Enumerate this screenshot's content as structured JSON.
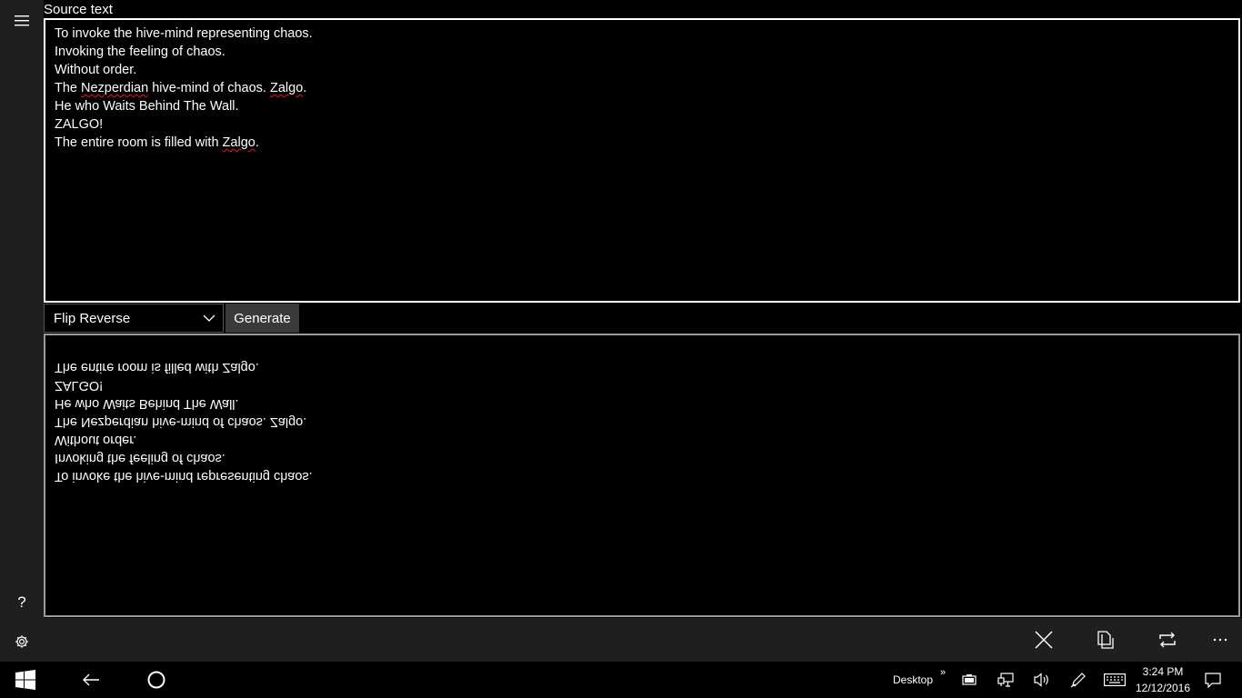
{
  "source": {
    "label": "Source text",
    "lines": [
      {
        "parts": [
          {
            "t": "To invoke the hive-mind representing chaos."
          }
        ]
      },
      {
        "parts": [
          {
            "t": "Invoking the feeling of chaos."
          }
        ]
      },
      {
        "parts": [
          {
            "t": "Without order."
          }
        ]
      },
      {
        "parts": [
          {
            "t": "The "
          },
          {
            "t": "Nezperdian",
            "spell": true
          },
          {
            "t": " hive-mind of chaos. "
          },
          {
            "t": "Zalgo",
            "spell": true
          },
          {
            "t": "."
          }
        ]
      },
      {
        "parts": [
          {
            "t": "He who Waits Behind The Wall."
          }
        ]
      },
      {
        "parts": [
          {
            "t": "ZALGO!"
          }
        ]
      },
      {
        "parts": [
          {
            "t": "The entire room is filled with "
          },
          {
            "t": "Zalgo",
            "spell": true
          },
          {
            "t": "."
          }
        ]
      }
    ]
  },
  "controls": {
    "mode_selected": "Flip Reverse",
    "generate_label": "Generate"
  },
  "output": {
    "lines": [
      "The entire room is filled with Zalgo.",
      "ZALGO!",
      "He who Waits Behind The Wall.",
      "The Nezperdian hive-mind of chaos. Zalgo.",
      "Without order.",
      "Invoking the feeling of chaos.",
      "To invoke the hive-mind representing chaos."
    ]
  },
  "rail": {
    "icons": [
      "hamburger-menu-icon",
      "help-icon",
      "settings-gear-icon"
    ],
    "help_glyph": "?"
  },
  "command_bar": {
    "icons": [
      "close-icon",
      "copy-icon",
      "repeat-icon",
      "more-icon"
    ]
  },
  "taskbar": {
    "desktop_label": "Desktop",
    "desktop_chevron": "»",
    "time": "3:24 PM",
    "date": "12/12/2016"
  },
  "colors": {
    "background": "#000000",
    "rail": "#1f1f1f",
    "generate_button": "#3a3a3a",
    "spellcheck": "#e81123"
  }
}
